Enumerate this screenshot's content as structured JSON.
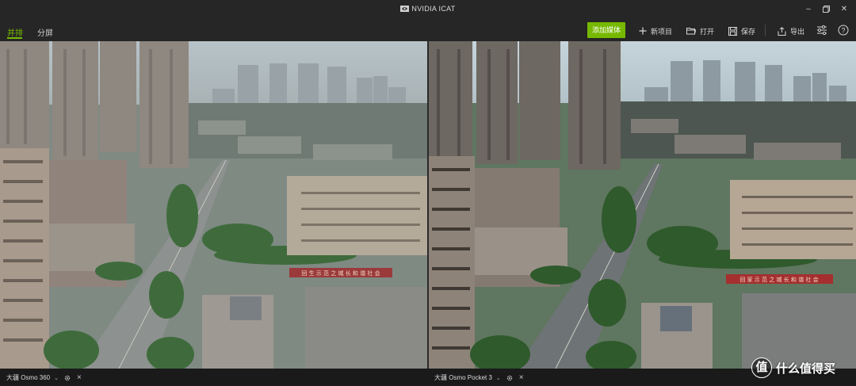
{
  "app": {
    "title": "NVIDIA ICAT"
  },
  "tabs": [
    {
      "label": "并排",
      "active": true
    },
    {
      "label": "分屏",
      "active": false
    }
  ],
  "toolbar": {
    "add_media": "添加媒体",
    "new_project": "新项目",
    "open": "打开",
    "save": "保存",
    "export": "导出"
  },
  "sources": [
    {
      "label": "大疆 Osmo 360"
    },
    {
      "label": "大疆 Osmo Pocket 3"
    }
  ],
  "watermark": {
    "badge": "值",
    "text": "什么值得买"
  },
  "scene": {
    "left_banner": "回 生 示 范 之 城 长 和 谐 社 会",
    "right_banner": "回 家 示 范 之 城 长 和 谐 社 会"
  },
  "colors": {
    "accent": "#76b900",
    "chrome": "#262626",
    "bottom": "#1a1a1a"
  },
  "icons": {
    "minimize": "minimize-icon",
    "maximize": "maximize-icon",
    "close": "close-icon",
    "settings": "sliders-icon",
    "help": "help-icon"
  }
}
